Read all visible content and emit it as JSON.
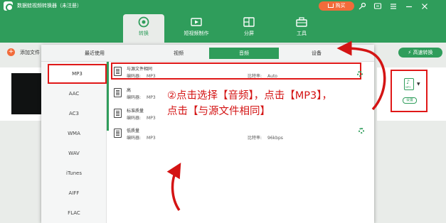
{
  "window": {
    "title": "数据蛙视频转换器（未注册）",
    "buy_label": "购买",
    "buttons": [
      "key-icon",
      "feedback-icon",
      "menu-icon",
      "minimize-icon",
      "close-icon"
    ]
  },
  "nav": {
    "tabs": [
      {
        "label": "转换",
        "icon": "convert-icon",
        "active": true
      },
      {
        "label": "短视频制作",
        "icon": "video-maker-icon",
        "active": false
      },
      {
        "label": "分屏",
        "icon": "split-screen-icon",
        "active": false
      },
      {
        "label": "工具",
        "icon": "toolbox-icon",
        "active": false
      }
    ]
  },
  "toolbar": {
    "add_file_label": "添加文件",
    "speed_convert_label": "高速转换"
  },
  "format_panel": {
    "categories": [
      {
        "label": "最近使用",
        "active": false
      },
      {
        "label": "视频",
        "active": false
      },
      {
        "label": "音频",
        "active": true
      },
      {
        "label": "设备",
        "active": false
      }
    ],
    "formats": [
      {
        "label": "MP3",
        "selected": true
      },
      {
        "label": "AAC",
        "selected": false
      },
      {
        "label": "AC3",
        "selected": false
      },
      {
        "label": "WMA",
        "selected": false
      },
      {
        "label": "WAV",
        "selected": false
      },
      {
        "label": "iTunes",
        "selected": false
      },
      {
        "label": "AIFF",
        "selected": false
      },
      {
        "label": "FLAC",
        "selected": false
      }
    ],
    "presets": [
      {
        "name": "与源文件相同",
        "encoder_label": "编码器:",
        "encoder": "MP3",
        "bitrate_label": "比特率:",
        "bitrate": "Auto",
        "selected": true
      },
      {
        "name": "高",
        "encoder_label": "编码器:",
        "encoder": "MP3",
        "bitrate_label": "",
        "bitrate": "",
        "selected": false
      },
      {
        "name": "标准质量",
        "encoder_label": "编码器:",
        "encoder": "MP3",
        "bitrate_label": "",
        "bitrate": "",
        "selected": false
      },
      {
        "name": "低质量",
        "encoder_label": "编码器:",
        "encoder": "MP3",
        "bitrate_label": "比特率:",
        "bitrate": "96kbps",
        "selected": false
      }
    ]
  },
  "output_format": {
    "file_ext": "MP3",
    "setting_label": "设置"
  },
  "annotation": {
    "line1": "②点击选择【音频】，点击【MP3】，",
    "line2": "点击【与源文件相同】"
  },
  "colors": {
    "brand_green": "#2f9d5b",
    "accent_orange": "#f26b3a",
    "highlight_red": "#e01818"
  }
}
